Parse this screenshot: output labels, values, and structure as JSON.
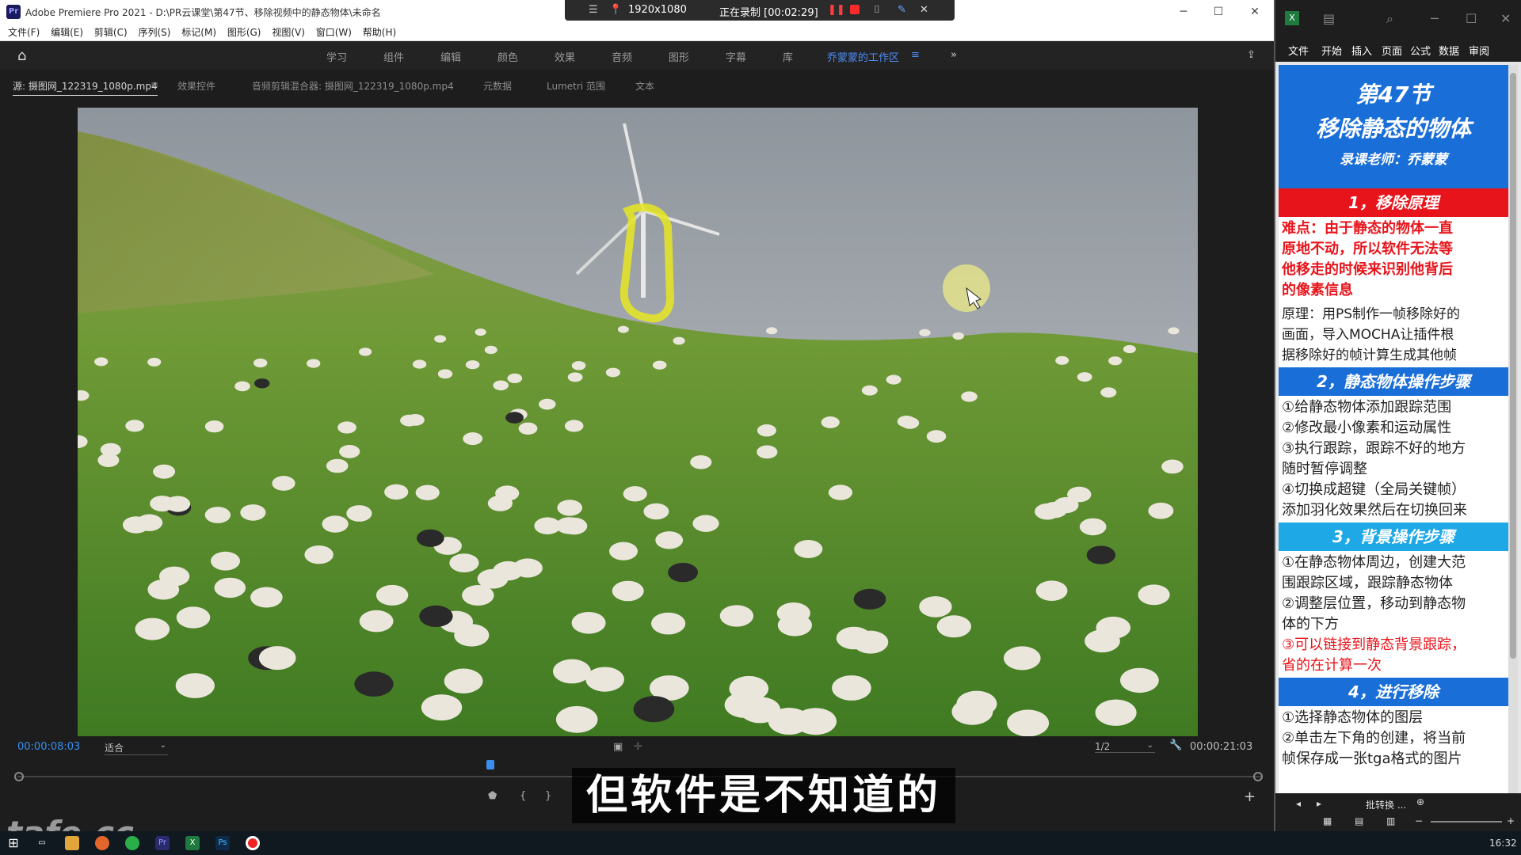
{
  "premiere": {
    "app_icon": "Pr",
    "title": "Adobe Premiere Pro 2021 - D:\\PR云课堂\\第47节、移除视频中的静态物体\\未命名",
    "menu": [
      "文件(F)",
      "编辑(E)",
      "剪辑(C)",
      "序列(S)",
      "标记(M)",
      "图形(G)",
      "视图(V)",
      "窗口(W)",
      "帮助(H)"
    ],
    "workspaces": [
      "学习",
      "组件",
      "编辑",
      "颜色",
      "效果",
      "音频",
      "图形",
      "字幕",
      "库",
      "乔蒙蒙的工作区"
    ],
    "active_workspace": "乔蒙蒙的工作区",
    "more_glyph": "»",
    "tabs": [
      "源: 摄图网_122319_1080p.mp4",
      "效果控件",
      "音频剪辑混合器: 摄图网_122319_1080p.mp4",
      "元数据",
      "Lumetri 范围",
      "文本"
    ],
    "timecode_current": "00:00:08:03",
    "fit_label": "适合",
    "resolution": "1/2",
    "timecode_duration": "00:00:21:03"
  },
  "recorder": {
    "resolution": "1920x1080",
    "status": "正在录制 [00:02:29]"
  },
  "subtitle": "但软件是不知道的",
  "watermark": "tafe.cc",
  "clock": "16:32",
  "excel": {
    "ribbon": [
      "文件",
      "开始",
      "插入",
      "页面",
      "公式",
      "数据",
      "审阅"
    ],
    "header_title": "第47节",
    "header_subtitle": "移除静态的物体",
    "header_teacher": "录课老师：乔蒙蒙",
    "sections": [
      {
        "title": "1，移除原理",
        "style": "red",
        "lines_red": [
          "难点：由于静态的物体一直",
          "原地不动，所以软件无法等",
          "他移走的时候来识别他背后",
          "的像素信息"
        ],
        "lines": [
          "原理：用PS制作一帧移除好的",
          "画面，导入MOCHA让插件根",
          "据移除好的帧计算生成其他帧"
        ]
      },
      {
        "title": "2，静态物体操作步骤",
        "style": "blue",
        "lines": [
          "①给静态物体添加跟踪范围",
          "②修改最小像素和运动属性",
          "③执行跟踪，跟踪不好的地方",
          "随时暂停调整",
          "④切换成超键（全局关键帧）",
          "添加羽化效果然后在切换回来"
        ]
      },
      {
        "title": "3，背景操作步骤",
        "style": "cyan",
        "lines": [
          "①在静态物体周边，创建大范",
          "围跟踪区域，跟踪静态物体",
          "②调整层位置，移动到静态物",
          "体的下方"
        ],
        "lines_red": [
          "③可以链接到静态背景跟踪，",
          "省的在计算一次"
        ]
      },
      {
        "title": "4，进行移除",
        "style": "blue",
        "lines": [
          "①选择静态物体的图层",
          "②单击左下角的创建，将当前",
          "帧保存成一张tga格式的图片"
        ]
      }
    ],
    "sheet_tab": "批转换 ..."
  },
  "colors": {
    "accent_blue": "#3b8ef0",
    "excel_red": "#e8141b",
    "excel_blue": "#1a6ed8",
    "excel_cyan": "#1fa8e6"
  }
}
